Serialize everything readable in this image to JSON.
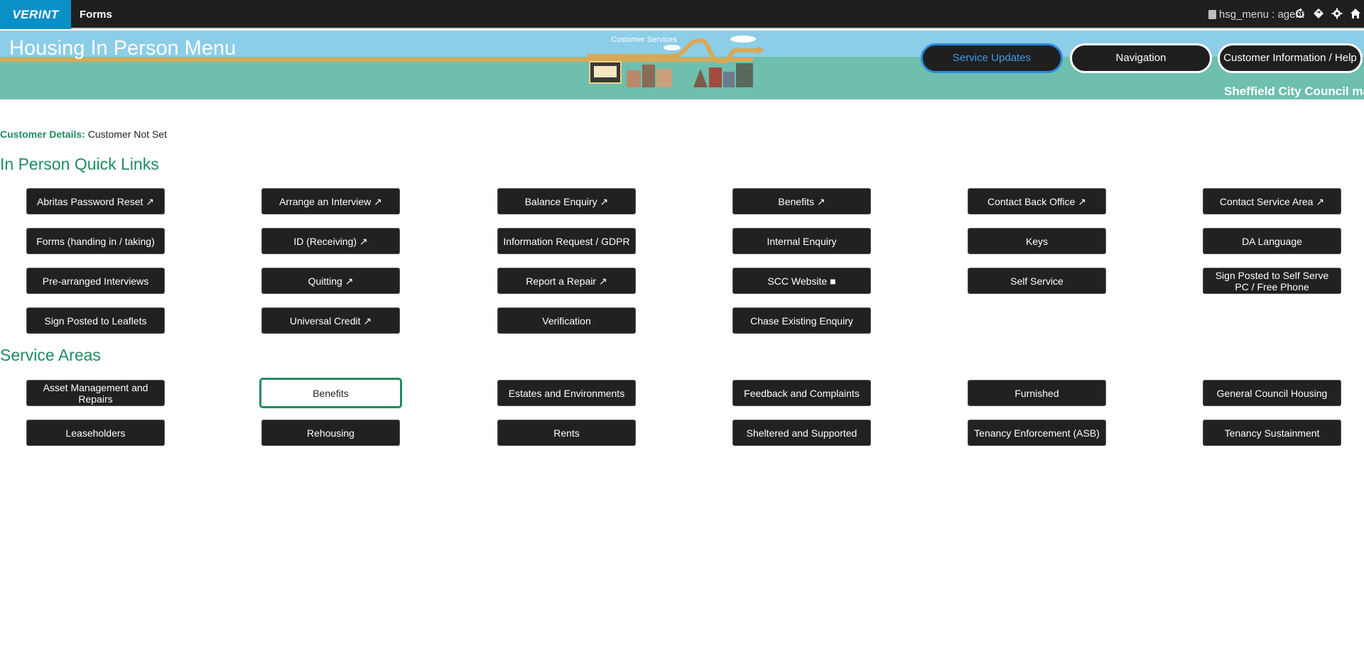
{
  "topbar": {
    "logo": "VERINT",
    "app_title": "Forms",
    "user": "hsg_menu : agent",
    "icons": [
      "refresh-icon",
      "diamond-nav-icon",
      "gear-icon",
      "home-icon"
    ]
  },
  "banner": {
    "title": "Housing In Person Menu",
    "art_label": "Customer Services",
    "buttons": [
      "Service Updates",
      "Navigation",
      "Customer Information / Help"
    ],
    "ticker": "Sheffield City Council ma"
  },
  "customer": {
    "label": "Customer Details:",
    "value": "Customer Not Set"
  },
  "quick_links": {
    "heading": "In Person Quick Links",
    "items": [
      "Abritas Password Reset ↗",
      "Arrange an Interview ↗",
      "Balance Enquiry ↗",
      "Benefits ↗",
      "Contact Back Office ↗",
      "Contact Service Area ↗",
      "Forms (handing in / taking)",
      "ID (Receiving) ↗",
      "Information Request / GDPR",
      "Internal Enquiry",
      "Keys",
      "DA Language",
      "Pre-arranged Interviews",
      "Quitting ↗",
      "Report a Repair ↗",
      "SCC Website ■",
      "Self Service",
      "Sign Posted to Self Serve PC / Free Phone",
      "Sign Posted to Leaflets",
      "Universal Credit ↗",
      "Verification",
      "Chase Existing Enquiry"
    ]
  },
  "service_areas": {
    "heading": "Service Areas",
    "items": [
      "Asset Management and Repairs",
      "Benefits",
      "Estates and Environments",
      "Feedback and Complaints",
      "Furnished",
      "General Council Housing",
      "Leaseholders",
      "Rehousing",
      "Rents",
      "Sheltered and Supported",
      "Tenancy Enforcement (ASB)",
      "Tenancy Sustainment"
    ],
    "selected": "Benefits"
  },
  "colors": {
    "accent_green": "#1d8c5f",
    "topbar": "#1f1f1f",
    "logo_blue": "#0a8fc7",
    "sky": "#8ccde8",
    "grass": "#6ebfae"
  }
}
